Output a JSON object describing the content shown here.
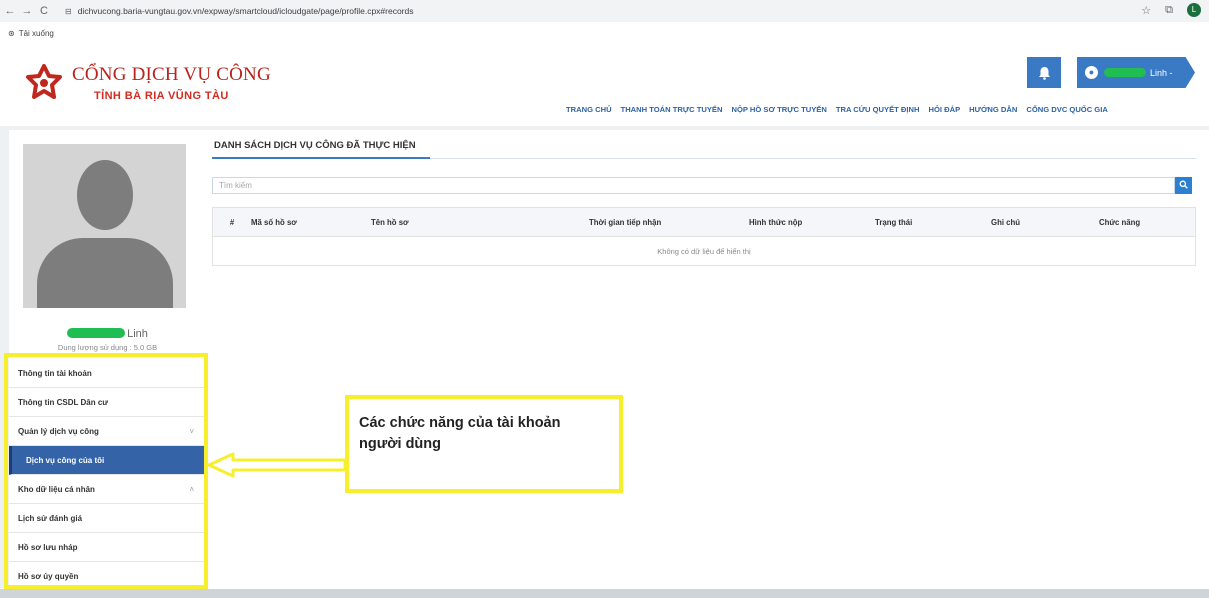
{
  "browser": {
    "back_icon": "←",
    "forward_icon": "→",
    "reload_icon": "C",
    "site_icon": "⊟",
    "url": "dichvucong.baria-vungtau.gov.vn/expway/smartcloud/icloudgate/page/profile.cpx#records",
    "profile_initial": "L",
    "bookmark": "Tải xuống"
  },
  "header": {
    "brand_title": "CỔNG DỊCH VỤ CÔNG",
    "brand_subtitle": "TỈNH BÀ RỊA VŨNG TÀU",
    "user_name_suffix": "Linh -",
    "nav": [
      "TRANG CHỦ",
      "THANH TOÁN TRỰC TUYẾN",
      "NỘP HỒ SƠ TRỰC TUYẾN",
      "TRA CỨU QUYẾT ĐỊNH",
      "HỎI ĐÁP",
      "HƯỚNG DẪN",
      "CỔNG DVC QUỐC GIA"
    ]
  },
  "sidebar": {
    "user_name": "Linh",
    "storage": "Dung lượng sử dụng : 5.0 GB",
    "items": [
      {
        "label": "Thông tin tài khoản"
      },
      {
        "label": "Thông tin CSDL Dân cư"
      },
      {
        "label": "Quản lý dịch vụ công"
      },
      {
        "label": "Dịch vụ công của tôi"
      },
      {
        "label": "Kho dữ liệu cá nhân"
      },
      {
        "label": "Lịch sử đánh giá"
      },
      {
        "label": "Hồ sơ lưu nháp"
      },
      {
        "label": "Hồ sơ ủy quyền"
      }
    ]
  },
  "content": {
    "title": "DANH SÁCH DỊCH VỤ CÔNG ĐÃ THỰC HIỆN",
    "search_placeholder": "Tìm kiếm",
    "columns": [
      "#",
      "Mã số hồ sơ",
      "Tên hồ sơ",
      "Thời gian tiếp nhận",
      "Hình thức nộp",
      "Trạng thái",
      "Ghi chú",
      "Chức năng"
    ],
    "empty_message": "Không có dữ liệu để hiển thị"
  },
  "annotation": {
    "callout_line1": "Các chức năng của tài khoản",
    "callout_line2": "người dùng",
    "highlight_color": "#f7ee2c"
  }
}
